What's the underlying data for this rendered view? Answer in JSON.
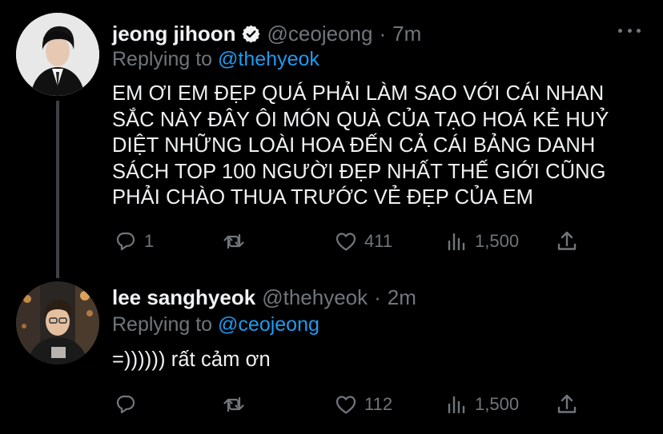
{
  "tweets": [
    {
      "name": "jeong jihoon",
      "handle": "@ceojeong",
      "time": "7m",
      "replying_prefix": "Replying to",
      "replying_to": "@thehyeok",
      "text_lines": [
        "EM ƠI EM ĐẸP QUÁ PHẢI LÀM SAO VỚI CÁI NHAN",
        "SẮC NÀY ĐÂY ÔI MÓN QUÀ CỦA TẠO HOÁ KẺ HUỶ",
        "DIỆT NHỮNG LOÀI HOA ĐẾN CẢ CÁI BẢNG DANH",
        "SÁCH TOP 100 NGƯỜI ĐẸP NHẤT THẾ GIỚI CŨNG",
        "PHẢI CHÀO THUA TRƯỚC VẺ ĐẸP CỦA EM"
      ],
      "reply_count": "1",
      "retweet_count": "",
      "like_count": "411",
      "view_count": "1,500",
      "icons": [
        "verified-badge-icon",
        "more-options-icon",
        "reply-icon",
        "retweet-icon",
        "like-icon",
        "views-icon",
        "share-icon"
      ]
    },
    {
      "name": "lee sanghyeok",
      "handle": "@thehyeok",
      "time": "2m",
      "replying_prefix": "Replying to",
      "replying_to": "@ceojeong",
      "text": "=)))))) rất cảm ơn",
      "reply_count": "",
      "retweet_count": "",
      "like_count": "112",
      "view_count": "1,500"
    }
  ],
  "separator": "·",
  "colors": {
    "background": "#000000",
    "text": "#e7e9ea",
    "muted": "#71767b",
    "link": "#1d9bf0",
    "thread_line": "#3d4145"
  }
}
